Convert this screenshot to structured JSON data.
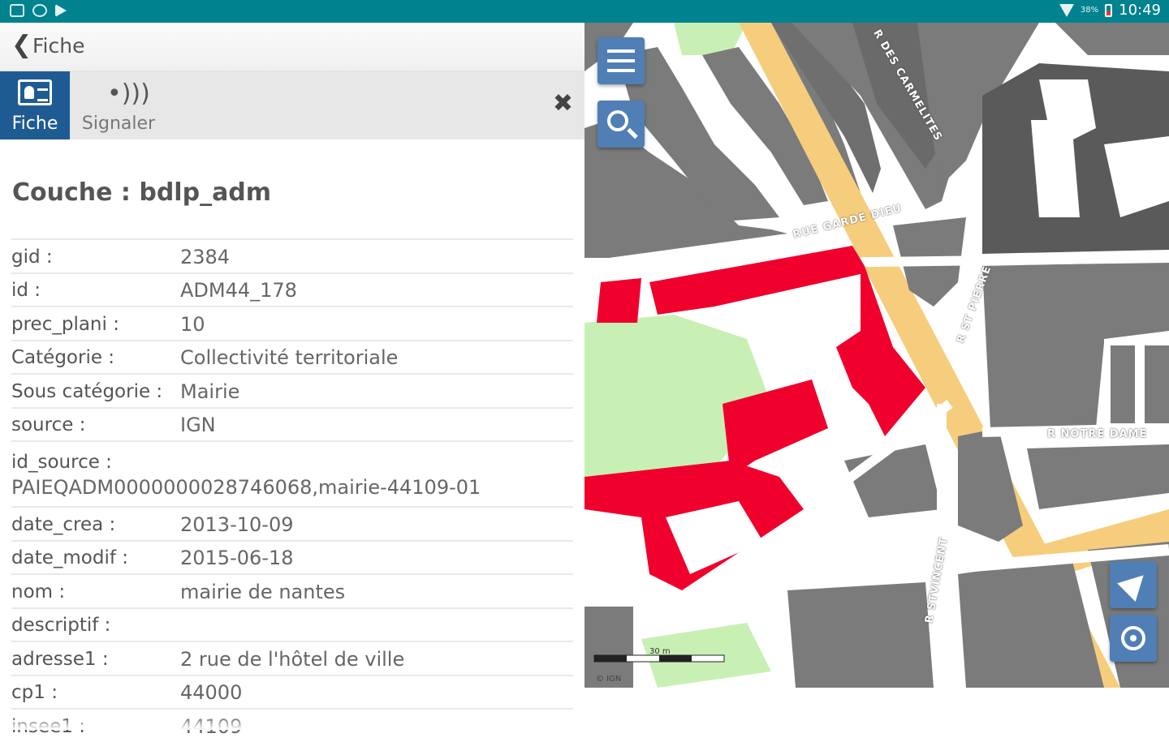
{
  "status_bar": {
    "time": "10:49",
    "battery": "38%",
    "colors": {
      "bar": "#00838f"
    }
  },
  "app_bar": {
    "back_icon": "chevron-left-icon",
    "title": "Fiche"
  },
  "tabs": [
    {
      "label": "Fiche",
      "icon": "id-card-icon",
      "active": true
    },
    {
      "label": "Signaler",
      "icon": "signal-icon",
      "active": false
    }
  ],
  "close_icon": "close-icon",
  "layer_title": "Couche : bdlp_adm",
  "attributes": [
    {
      "key": "gid :",
      "value": "2384"
    },
    {
      "key": "id :",
      "value": "ADM44_178"
    },
    {
      "key": "prec_plani :",
      "value": "10"
    },
    {
      "key": "Catégorie :",
      "value": "Collectivité territoriale"
    },
    {
      "key": "Sous catégorie :",
      "value": "Mairie"
    },
    {
      "key": "source :",
      "value": "IGN"
    },
    {
      "key": "id_source :",
      "value": "PAIEQADM0000000028746068,mairie-44109-01"
    },
    {
      "key": "date_crea :",
      "value": "2013-10-09"
    },
    {
      "key": "date_modif :",
      "value": "2015-06-18"
    },
    {
      "key": "nom :",
      "value": "mairie de nantes"
    },
    {
      "key": "descriptif :",
      "value": ""
    },
    {
      "key": "adresse1 :",
      "value": "2 rue de l'hôtel de ville"
    },
    {
      "key": "cp1 :",
      "value": "44000"
    },
    {
      "key": "insee1 :",
      "value": "44109"
    }
  ],
  "map": {
    "buttons": {
      "menu": "menu-icon",
      "search": "search-icon",
      "navigate": "navigation-arrow-icon",
      "locate": "locate-icon"
    },
    "streets": {
      "gardedieu": "RUE GARDE DIEU",
      "notredame": "R NOTRE DAME",
      "lagrange": "R DES CARMELITES",
      "bresse": "R STVINCENT",
      "saintpierre": "R ST PIERRE"
    },
    "scale_label": "30 m",
    "copyright": "© IGN",
    "colors": {
      "highlight": "#f0002c",
      "block": "#7b7b7b",
      "dark_block": "#5a5a5a",
      "main_road": "#f6cd7c",
      "park": "#c8f0b4"
    }
  }
}
